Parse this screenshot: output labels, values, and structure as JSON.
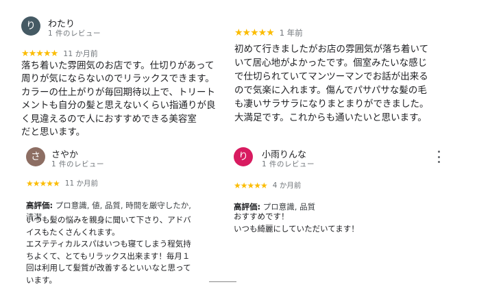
{
  "reviews": [
    {
      "avatar_letter": "り",
      "avatar_color": "#455a64",
      "name": "わたり",
      "review_count": "1 件のレビュー",
      "stars": "★★★★★",
      "date": "11 か月前",
      "text": "落ち着いた雰囲気のお店です。仕切りがあって\n周りが気にならないのでリラックスできます。\nカラーの仕上がりが毎回期待以上で、トリート\nメントも自分の髪と思えないくらい指通りが良\nく見違えるので人におすすめできる美容室\nだと思います。"
    },
    {
      "stars": "★★★★★",
      "date": "1 年前",
      "text": "初めて行きましたがお店の雰囲気が落ち着いて\nいて居心地がよかったです。個室みたいな感じ\nで仕切られていてマンツーマンでお話が出来る\nので気楽に入れます。傷んでパサパサな髪の毛\nも凄いサラサラになりまとまりができました。\n大満足です。これからも通いたいと思います。"
    },
    {
      "avatar_letter": "さ",
      "avatar_color": "#8d6e63",
      "name": "さやか",
      "review_count": "1 件のレビュー",
      "stars": "★★★★★",
      "date": "11 か月前",
      "highlight_label": "高評価:",
      "highlight_value": " プロ意識, 値, 品質, 時間を厳守したか,\n清潔",
      "text": "いつも髪の悩みを親身に聞いて下さり、アドバ\nイスもたくさんくれます。\nエステティカルスパはいつも寝てしまう程気持\nちよくて、とてもリラックス出来ます！毎月１\n回は利用して髪質が改善するといいなと思って\nいます。"
    },
    {
      "avatar_letter": "り",
      "avatar_color": "#d81b60",
      "name": "小雨りんな",
      "review_count": "1 件のレビュー",
      "stars": "★★★★★",
      "date": "4 か月前",
      "highlight_label": "高評価:",
      "highlight_value": " プロ意識, 品質",
      "text": "おすすめです！\nいつも綺麗にしていただいてます！"
    }
  ]
}
